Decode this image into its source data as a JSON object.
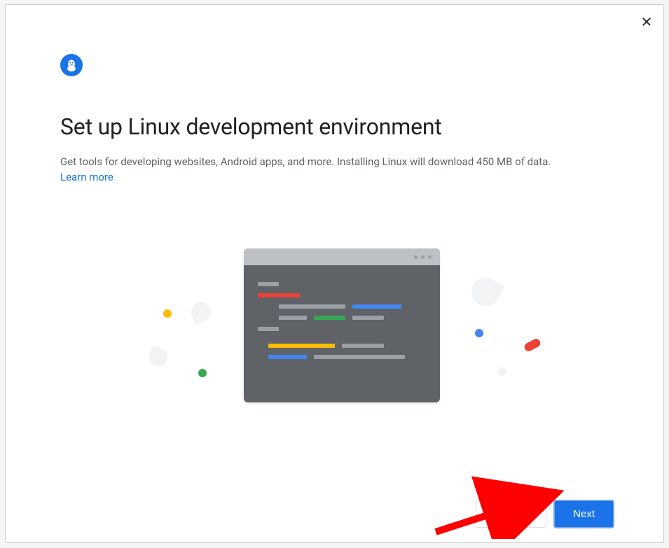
{
  "dialog": {
    "title": "Set up Linux development environment",
    "description": "Get tools for developing websites, Android apps, and more. Installing Linux will download 450 MB of data.",
    "learn_more_label": "Learn more"
  },
  "footer": {
    "cancel_label": "Cancel",
    "next_label": "Next"
  },
  "icons": {
    "close": "close-icon",
    "linux": "linux-penguin-icon"
  },
  "colors": {
    "primary": "#1a73e8",
    "text_primary": "#202124",
    "text_secondary": "#5f6368",
    "red": "#ea4335",
    "yellow": "#fbbc04",
    "green": "#34a853",
    "blue": "#4285f4"
  }
}
